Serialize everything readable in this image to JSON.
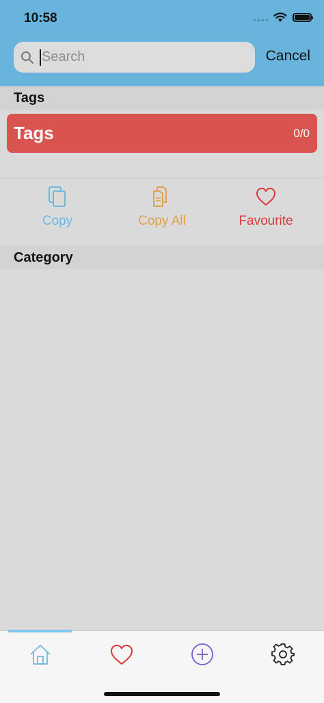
{
  "status": {
    "time": "10:58"
  },
  "search": {
    "placeholder": "Search",
    "value": "",
    "cancel_label": "Cancel"
  },
  "tags_section": {
    "header": "Tags",
    "bar_title": "Tags",
    "bar_count": "0/0"
  },
  "actions": [
    {
      "label": "Copy",
      "icon": "copy-icon",
      "color": "#6db9e2"
    },
    {
      "label": "Copy All",
      "icon": "copy-all-icon",
      "color": "#e0a24a"
    },
    {
      "label": "Favourite",
      "icon": "heart-icon",
      "color": "#d93a35"
    }
  ],
  "category_section": {
    "header": "Category"
  },
  "tabbar": {
    "tabs": [
      {
        "icon": "home-icon",
        "active": true,
        "color": "#6db9e2"
      },
      {
        "icon": "heart-icon",
        "active": false,
        "color": "#d93a35"
      },
      {
        "icon": "plus-circle-icon",
        "active": false,
        "color": "#7a5ccf"
      },
      {
        "icon": "gear-icon",
        "active": false,
        "color": "#222222"
      }
    ]
  },
  "colors": {
    "header_bg": "#68b4dd",
    "tags_bar": "#d9534f",
    "background": "#dadada"
  }
}
